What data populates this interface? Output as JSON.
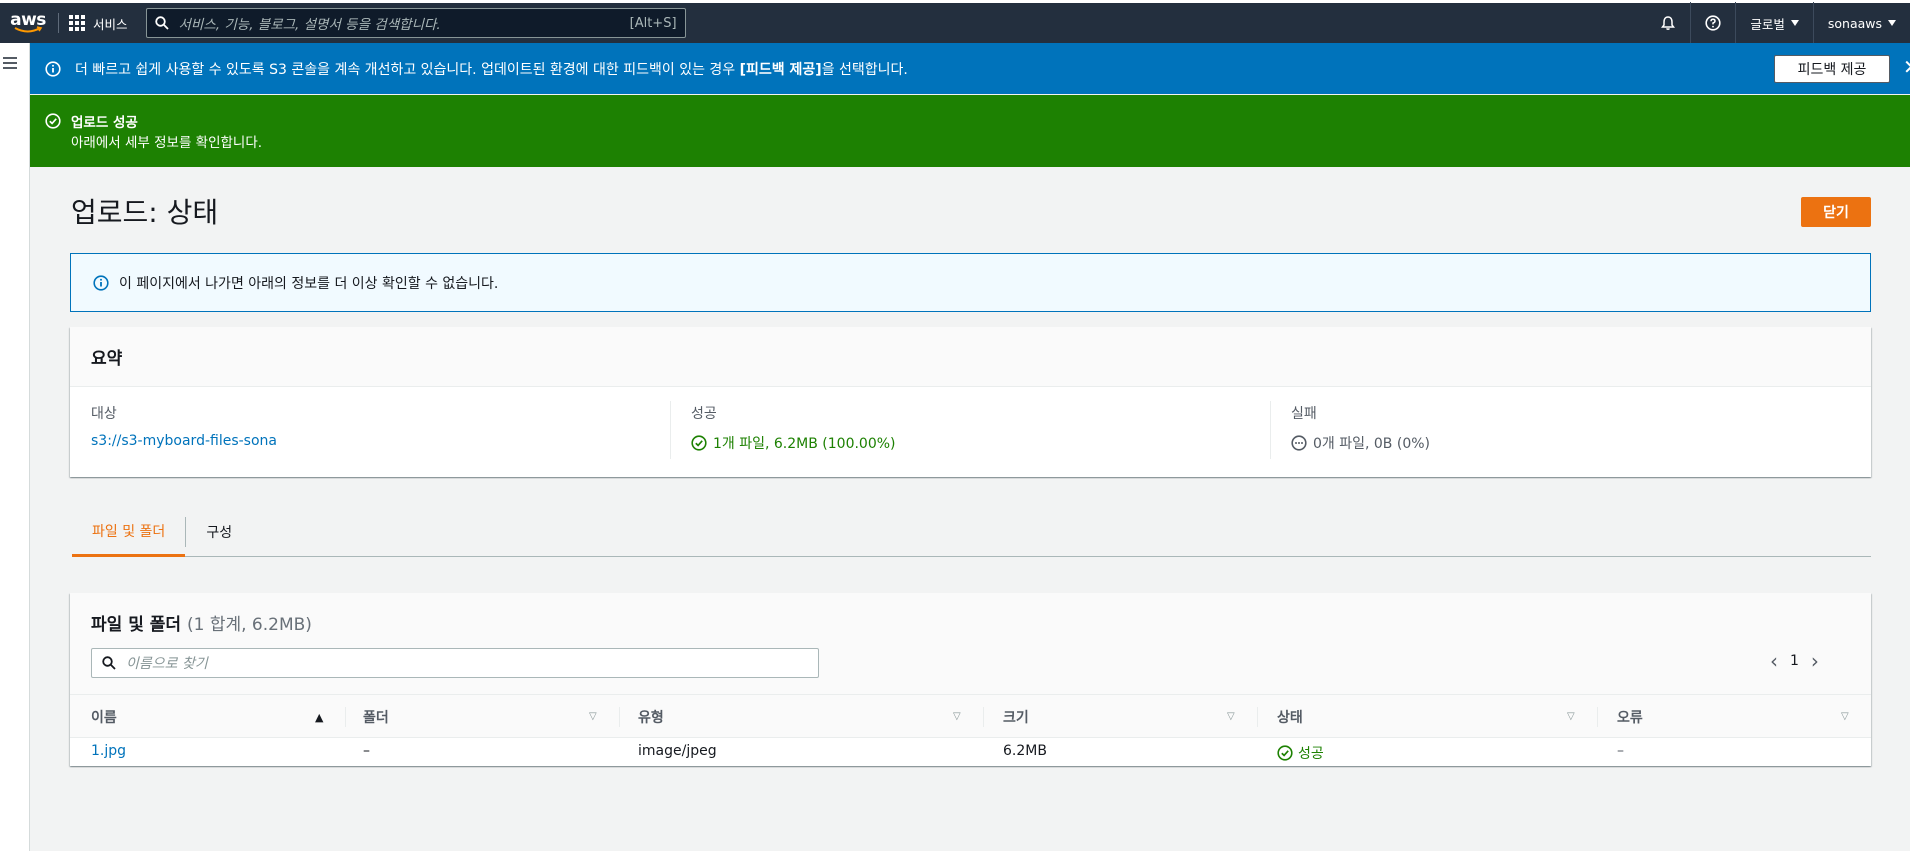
{
  "nav": {
    "logo_text": "aws",
    "services_label": "서비스",
    "search_placeholder": "서비스, 기능, 블로그, 설명서 등을 검색합니다.",
    "search_shortcut": "[Alt+S]",
    "region_label": "글로벌",
    "account_label": "sonaaws"
  },
  "flash_info": {
    "message_pre": "더 빠르고 쉽게 사용할 수 있도록 S3 콘솔을 계속 개선하고 있습니다. 업데이트된 환경에 대한 피드백이 있는 경우 ",
    "message_bold": "[피드백 제공]",
    "message_post": "을 선택합니다.",
    "button_label": "피드백 제공",
    "close_symbol": "✕"
  },
  "flash_success": {
    "title": "업로드 성공",
    "subtitle": "아래에서 세부 정보를 확인합니다."
  },
  "header": {
    "title": "업로드: 상태",
    "close_button": "닫기"
  },
  "alert": {
    "text": "이 페이지에서 나가면 아래의 정보를 더 이상 확인할 수 없습니다."
  },
  "summary": {
    "title": "요약",
    "destination_label": "대상",
    "destination_value": "s3://s3-myboard-files-sona",
    "success_label": "성공",
    "success_value": "1개 파일, 6.2MB (100.00%)",
    "failure_label": "실패",
    "failure_value": "0개 파일, 0B (0%)"
  },
  "tabs": [
    {
      "label": "파일 및 폴더",
      "active": true
    },
    {
      "label": "구성",
      "active": false
    }
  ],
  "files": {
    "title": "파일 및 폴더",
    "count": "(1 합계, 6.2MB)",
    "filter_placeholder": "이름으로 찾기",
    "page": "1",
    "columns": [
      "이름",
      "폴더",
      "유형",
      "크기",
      "상태",
      "오류"
    ],
    "rows": [
      {
        "name": "1.jpg",
        "folder": "–",
        "type": "image/jpeg",
        "size": "6.2MB",
        "status": "성공",
        "error": "–"
      }
    ]
  },
  "colors": {
    "nav_bg": "#232f3e",
    "info_blue": "#0073bb",
    "success_green": "#1d8102",
    "primary_orange": "#ec7211"
  }
}
